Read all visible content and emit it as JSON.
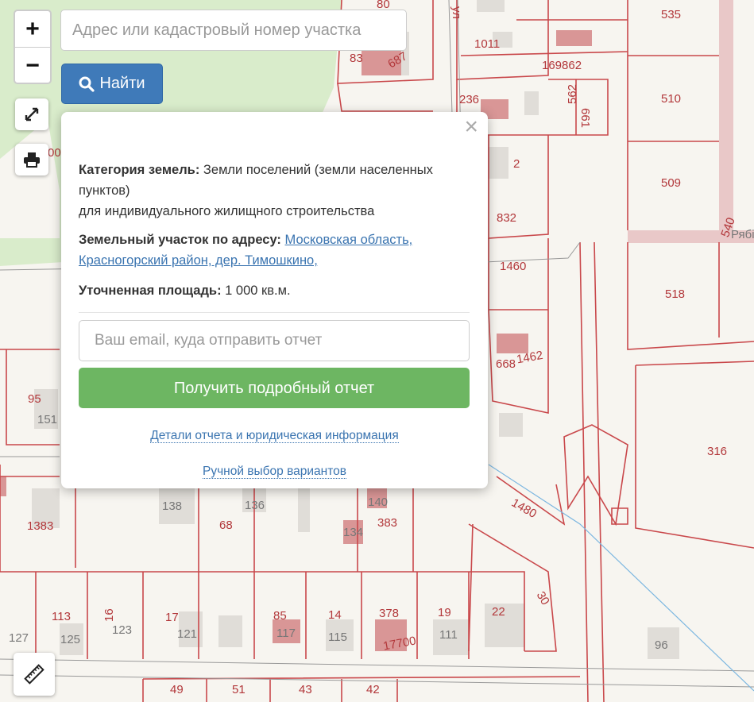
{
  "map": {
    "labels": [
      "80",
      "1011",
      "169862",
      "83",
      "687",
      "535",
      "510",
      "236",
      "562",
      "661",
      "2",
      "509",
      "832",
      "540",
      "1460",
      "518",
      "668",
      "1462",
      "95",
      "151",
      "316",
      "138",
      "136",
      "140",
      "1383",
      "68",
      "383",
      "134",
      "1480",
      "30",
      "113",
      "16",
      "17",
      "85",
      "14",
      "378",
      "19",
      "22",
      "127",
      "125",
      "123",
      "121",
      "117",
      "115",
      "17700",
      "111",
      "96",
      "49",
      "51",
      "43",
      "42",
      "00",
      "ул",
      "Рябі"
    ]
  },
  "controls": {
    "zoom_in": "+",
    "zoom_out": "−",
    "fullscreen_icon": "expand-icon",
    "print_icon": "printer-icon",
    "ruler_icon": "ruler-icon"
  },
  "search": {
    "placeholder": "Адрес или кадастровый номер участка",
    "value": "",
    "button_label": "Найти"
  },
  "popup": {
    "category_label": "Категория земель:",
    "category_value": "Земли поселений (земли населенных пунктов)",
    "usage": "для индивидуального жилищного строительства",
    "address_label": "Земельный участок по адресу:",
    "address_value": "Московская область, Красногорский район, дер. Тимошкино,",
    "area_label": "Уточненная площадь:",
    "area_value": "1 000 кв.м.",
    "email_placeholder": "Ваш email, куда отправить отчет",
    "report_button": "Получить подробный отчет",
    "details_link": "Детали отчета и юридическая информация",
    "manual_link": "Ручной выбор вариантов",
    "close": "×"
  },
  "colors": {
    "parcel_border": "#c9484b",
    "button_primary": "#3f7ab9",
    "button_success": "#6db662",
    "park": "#d9eccb"
  }
}
